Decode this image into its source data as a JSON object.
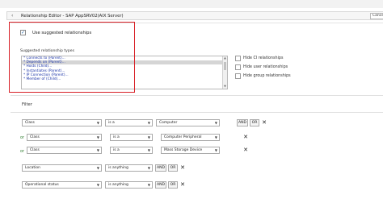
{
  "window": {
    "title": "Relationship Editor - SAP AppSRV02(AIX Server)",
    "cancel_label": "Cancel"
  },
  "suggested": {
    "checkbox_label": "Use suggested relationships",
    "checked": true,
    "types_label": "Suggested relationship types",
    "types": [
      "* Connects to (Parent)...",
      "* Depends on (Parent)...",
      "* Hosts (Child)...",
      "* Instantiates (Parent)...",
      "* IP Connection (Parent)...",
      "* Member of (Child)..."
    ],
    "selected_index": 1
  },
  "hide_options": [
    "Hide CI relationships",
    "Hide user relationships",
    "Hide group relationships"
  ],
  "filter": {
    "title": "Filter",
    "rows": [
      {
        "prefix": "",
        "field": "Class",
        "operator": "is a",
        "value": "Computer",
        "buttons": [
          "AND",
          "OR"
        ],
        "remove": true
      },
      {
        "prefix": "or",
        "field": "Class",
        "operator": "is a",
        "value": "Computer Peripheral",
        "buttons": [],
        "remove": true
      },
      {
        "prefix": "or",
        "field": "Class",
        "operator": "is a",
        "value": "Mass Storage Device",
        "buttons": [],
        "remove": true
      },
      {
        "prefix": "",
        "field": "Location",
        "operator": "is anything",
        "value": "",
        "buttons": [
          "AND",
          "OR"
        ],
        "remove": true
      },
      {
        "prefix": "",
        "field": "Operational status",
        "operator": "is anything",
        "value": "",
        "buttons": [
          "AND",
          "OR"
        ],
        "remove": true
      }
    ]
  },
  "colors": {
    "highlight": "#d81f26",
    "list_text": "#1a33a8",
    "or_text": "#2a7a2a"
  }
}
